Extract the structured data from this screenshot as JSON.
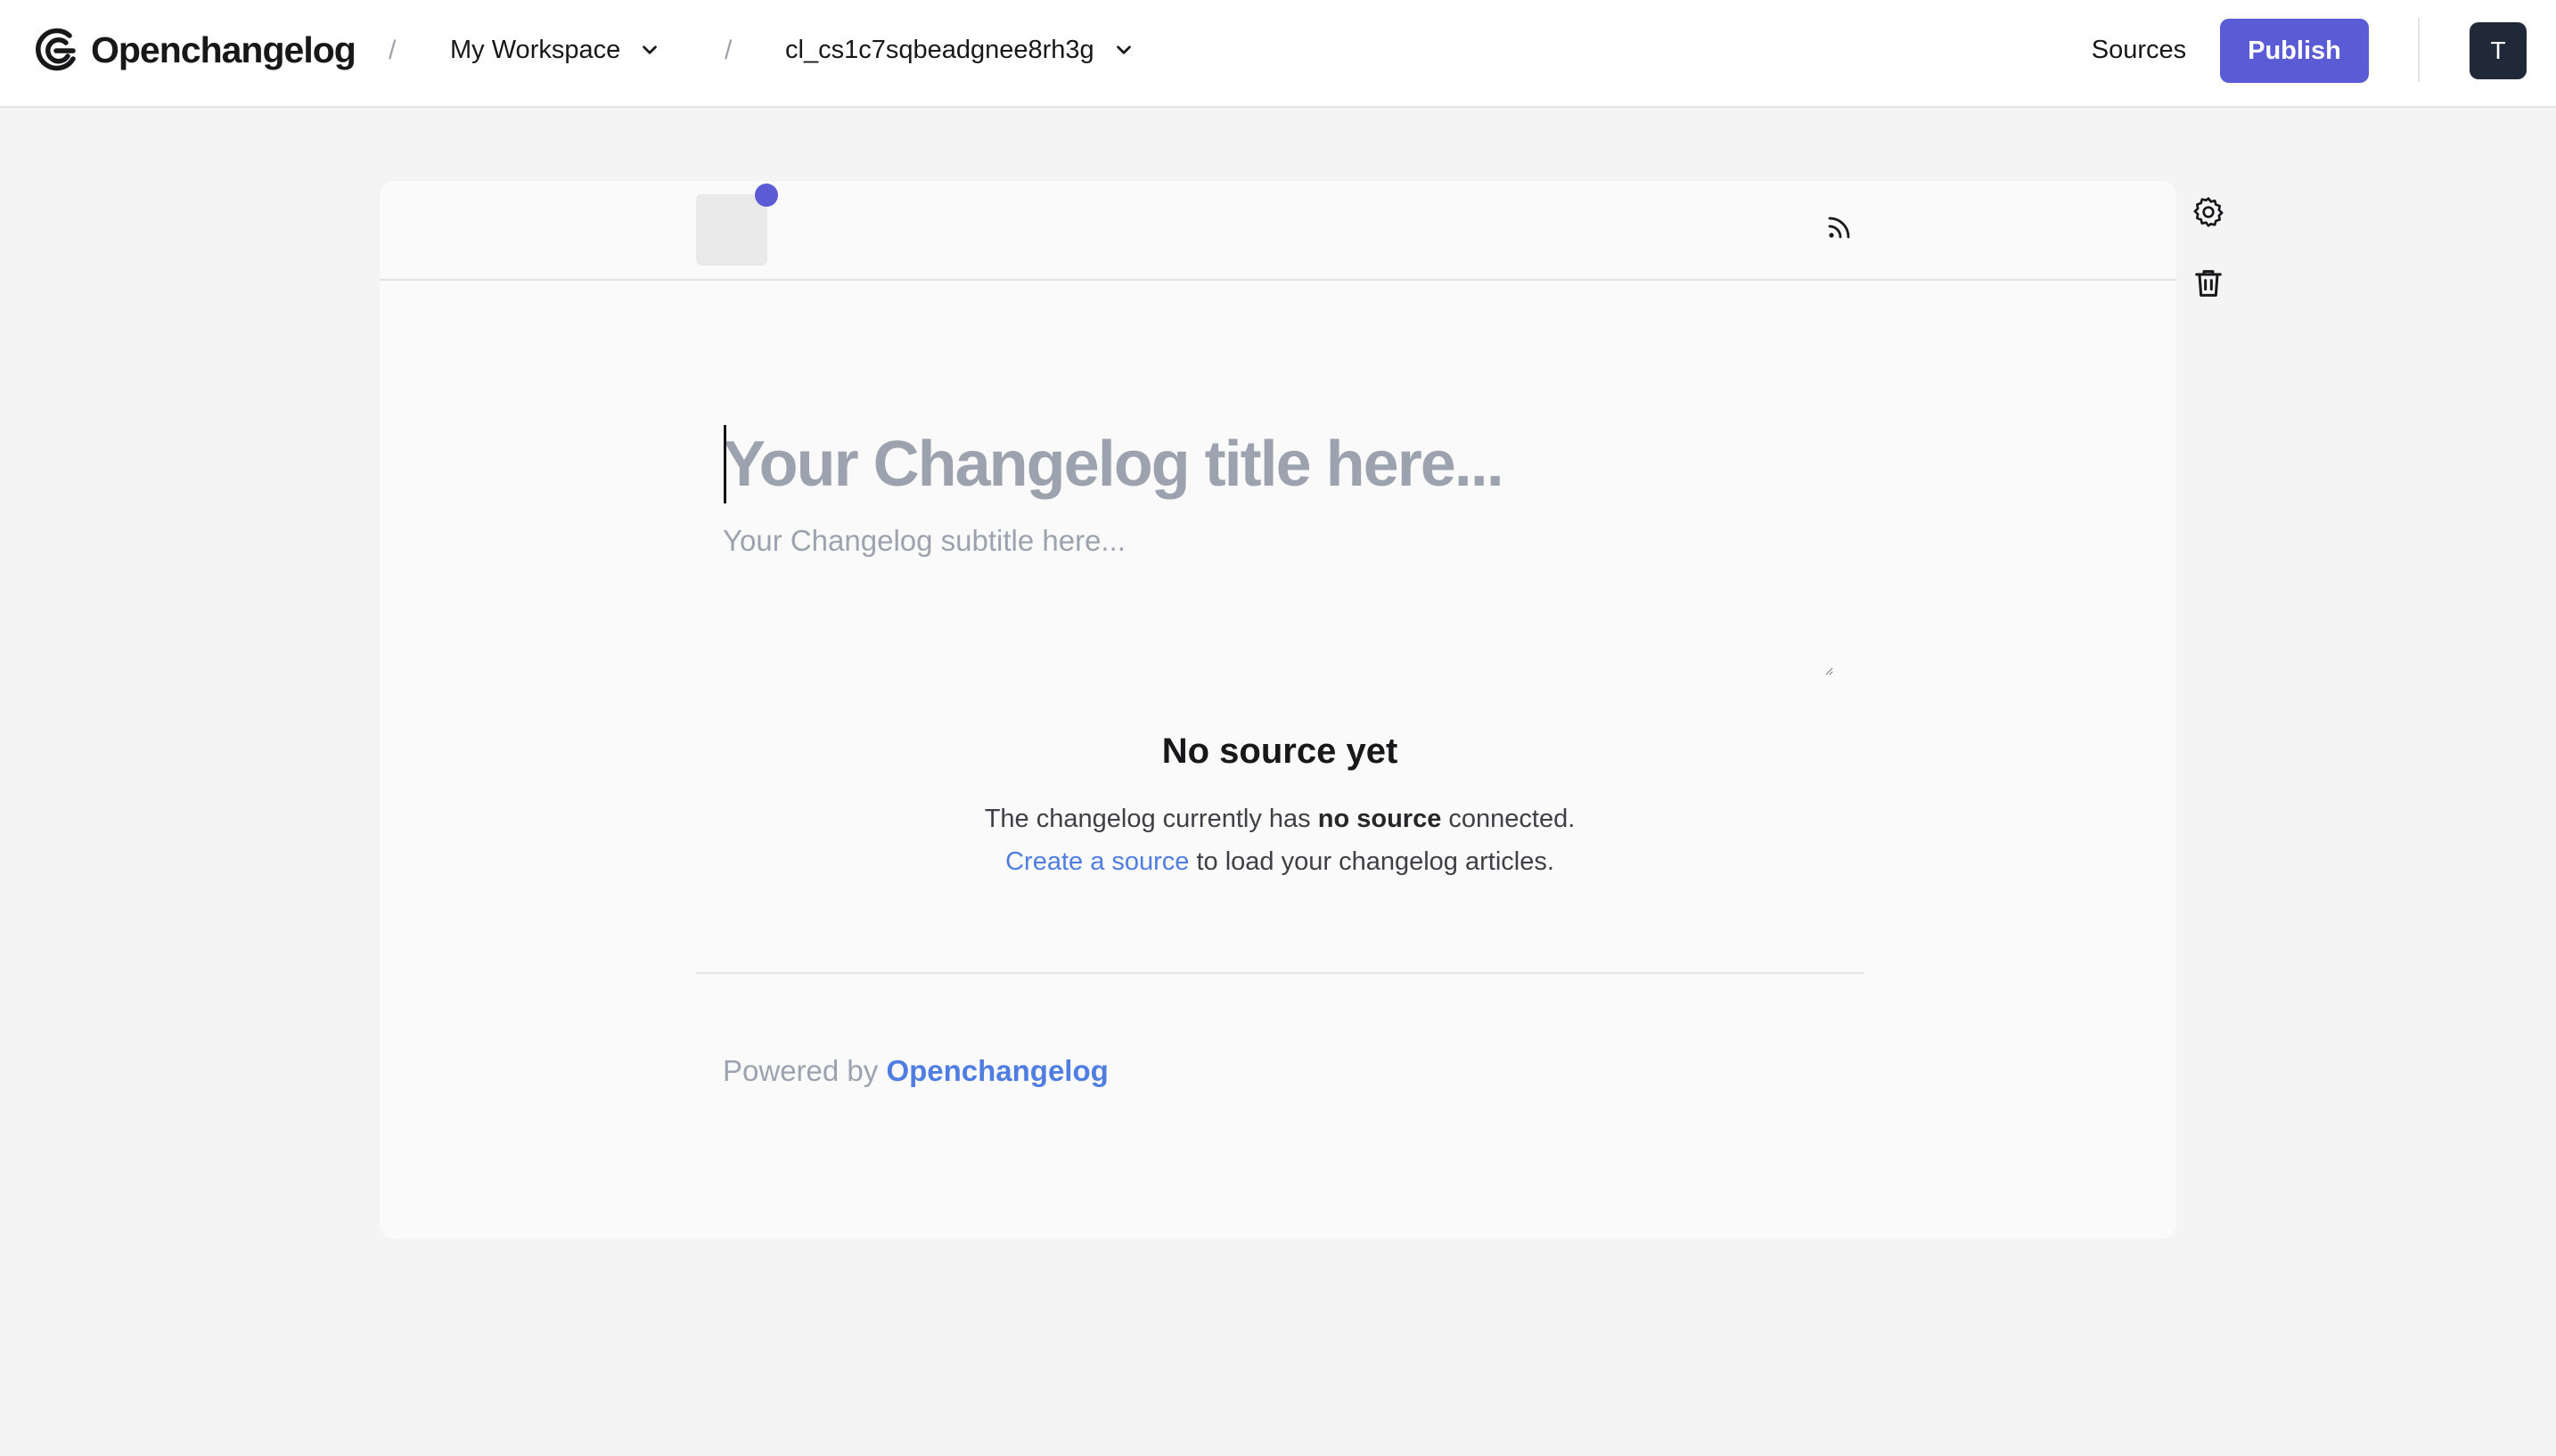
{
  "app": {
    "brand": "Openchangelog"
  },
  "breadcrumb": {
    "separator": "/",
    "workspace": "My Workspace",
    "changelog_id": "cl_cs1c7sqbeadgnee8rh3g"
  },
  "header": {
    "sources_label": "Sources",
    "publish_label": "Publish",
    "avatar_initial": "T"
  },
  "editor": {
    "title_placeholder": "Your Changelog title here...",
    "subtitle_placeholder": "Your Changelog subtitle here..."
  },
  "empty_state": {
    "heading": "No source yet",
    "line1_prefix": "The changelog currently has",
    "line1_bold": "no source",
    "line1_suffix": "connected.",
    "line2_link": "Create a source",
    "line2_suffix": "to load your changelog articles."
  },
  "footer": {
    "powered_prefix": "Powered by",
    "powered_link": "Openchangelog"
  },
  "icons": {
    "logo": "openchangelog-logo-icon",
    "rss": "rss-icon",
    "settings": "gear-icon",
    "delete": "trash-icon",
    "dropdown": "chevron-down-icon"
  },
  "colors": {
    "accent": "#5b5bd6",
    "link": "#4f7de2",
    "avatar_bg": "#1f2937",
    "page_bg": "#f4f4f5"
  }
}
